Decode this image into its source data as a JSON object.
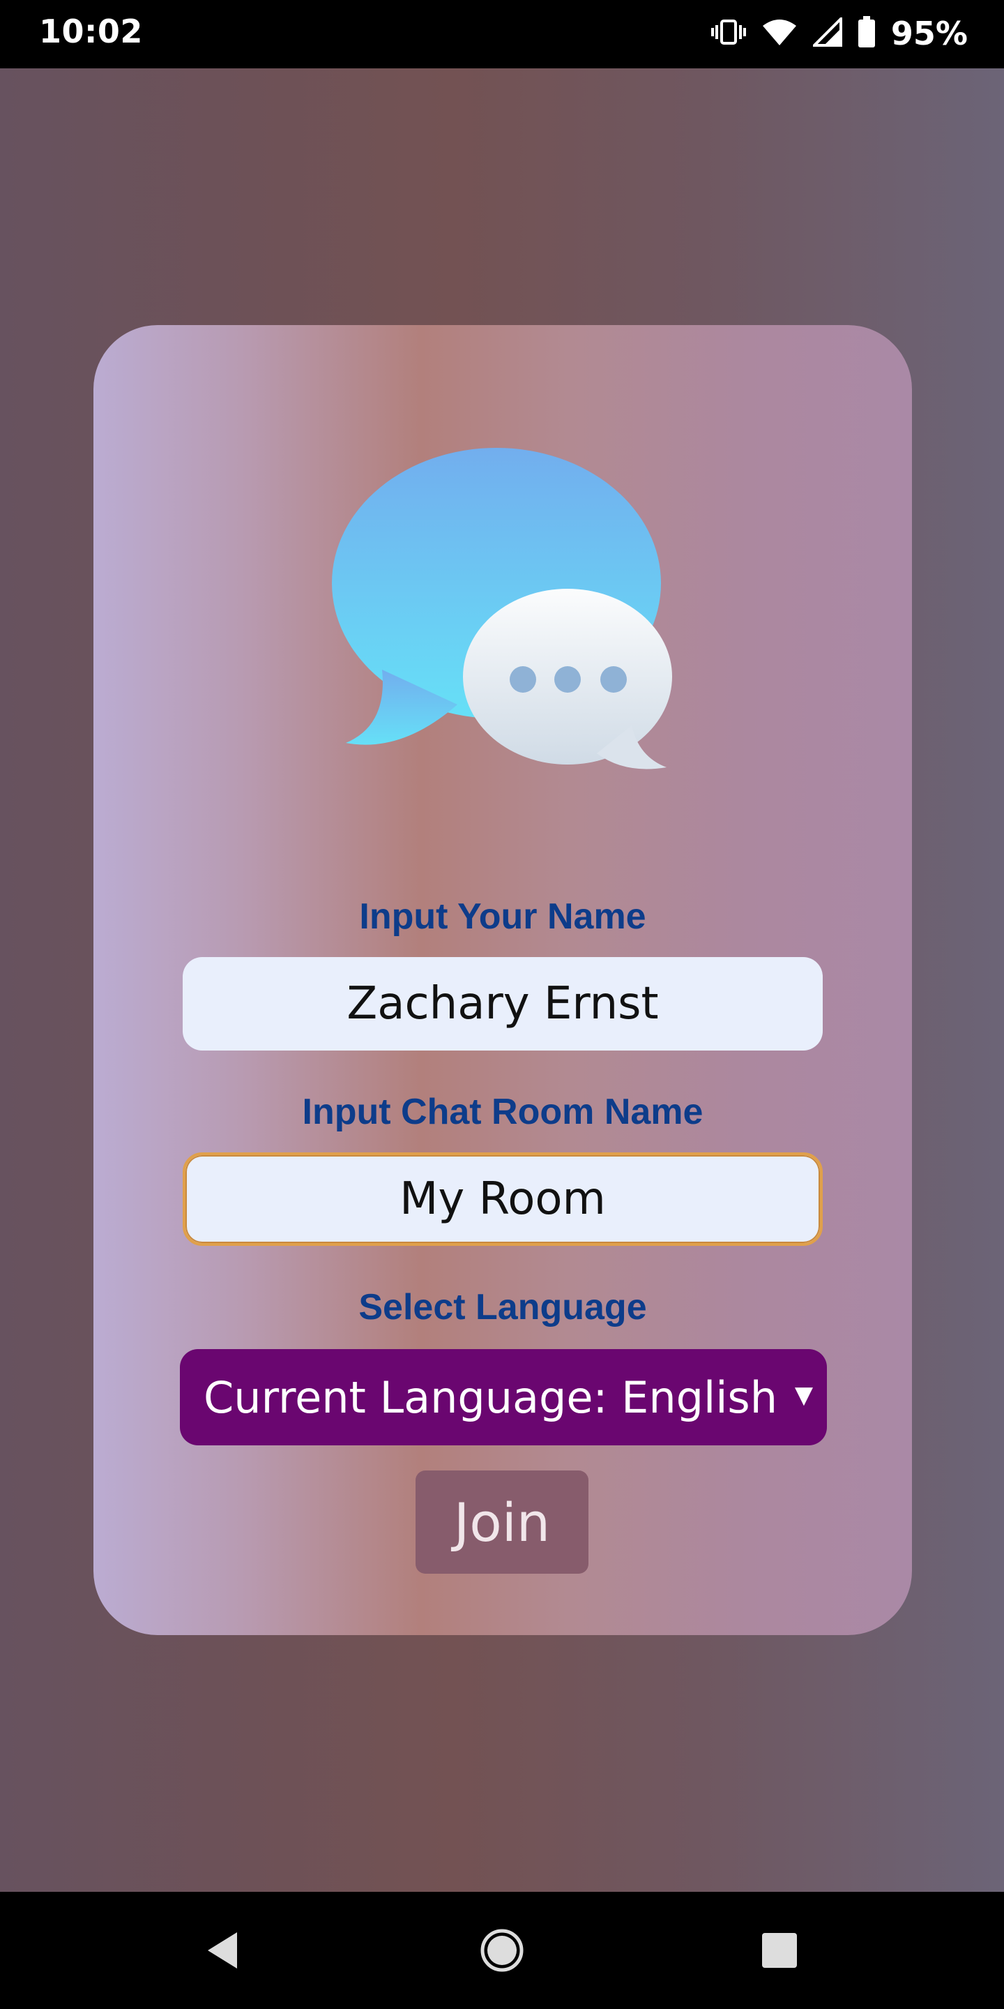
{
  "status_bar": {
    "time": "10:02",
    "battery_percent": "95%",
    "icons": [
      "vibrate-icon",
      "wifi-icon",
      "signal-icon",
      "battery-icon"
    ]
  },
  "login": {
    "name_label": "Input Your Name",
    "name_value": "Zachary Ernst",
    "room_label": "Input Chat Room Name",
    "room_value": "My Room",
    "language_label": "Select Language",
    "language_selected": "Current Language: English",
    "join_label": "Join"
  },
  "nav_bar": {
    "icons": [
      "back-icon",
      "home-icon",
      "recent-apps-icon"
    ]
  },
  "colors": {
    "label_text": "#0d3c8a",
    "select_bg": "#6a0670",
    "join_bg": "#875c6c",
    "focus_border": "#e0a04b"
  }
}
